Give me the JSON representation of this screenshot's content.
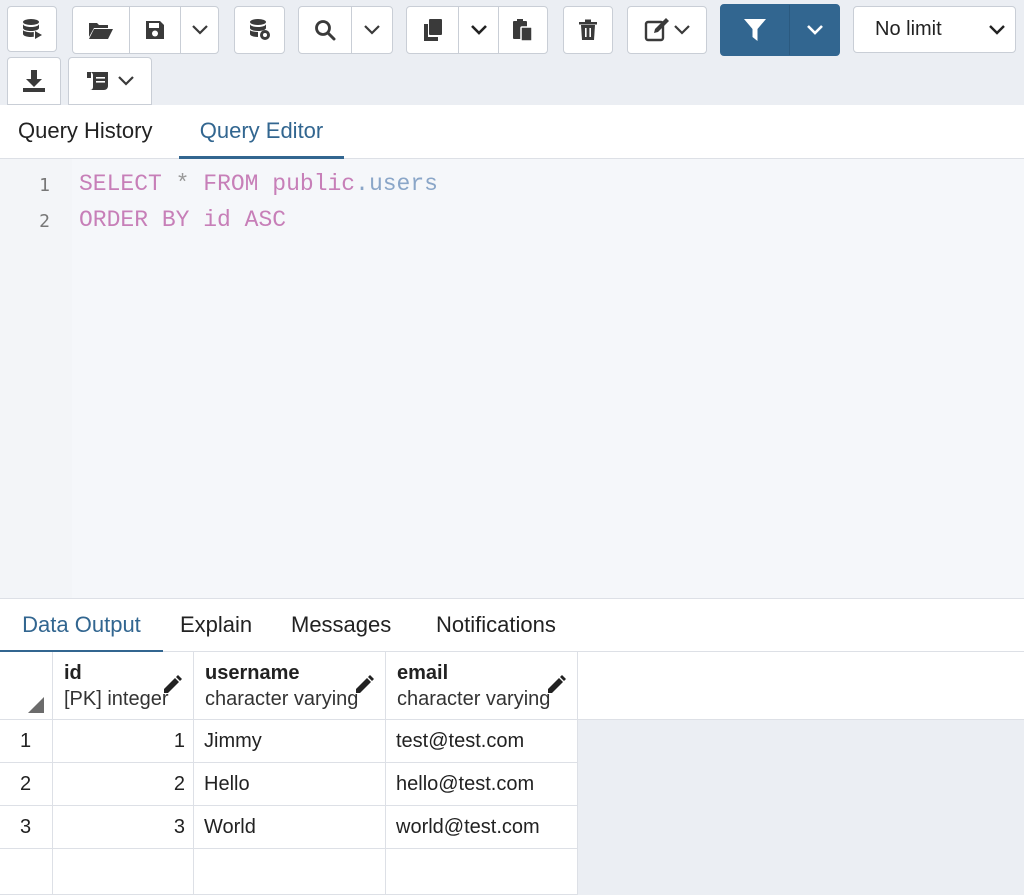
{
  "toolbar": {
    "limit_select": {
      "value": "No limit",
      "options": [
        "No limit"
      ]
    }
  },
  "tabs_top": [
    {
      "label": "Query History",
      "active": false
    },
    {
      "label": "Query Editor",
      "active": true
    }
  ],
  "editor": {
    "lines": [
      {
        "number": "1"
      },
      {
        "number": "2"
      }
    ],
    "line1": {
      "kw1": "SELECT",
      "op": "*",
      "kw2": "FROM",
      "schema": "public",
      "dot": ".",
      "table": "users"
    },
    "line2": {
      "kw1": "ORDER BY",
      "col": "id",
      "kw2": "ASC"
    }
  },
  "tabs_bottom": [
    {
      "label": "Data Output",
      "active": true
    },
    {
      "label": "Explain",
      "active": false
    },
    {
      "label": "Messages",
      "active": false
    },
    {
      "label": "Notifications",
      "active": false
    }
  ],
  "grid": {
    "columns": [
      {
        "name": "id",
        "type": "[PK] integer"
      },
      {
        "name": "username",
        "type": "character varying"
      },
      {
        "name": "email",
        "type": "character varying"
      }
    ],
    "rows": [
      {
        "rownum": "1",
        "id": "1",
        "username": "Jimmy",
        "email": "test@test.com"
      },
      {
        "rownum": "2",
        "id": "2",
        "username": "Hello",
        "email": "hello@test.com"
      },
      {
        "rownum": "3",
        "id": "3",
        "username": "World",
        "email": "world@test.com"
      }
    ]
  },
  "colors": {
    "accent": "#326690",
    "keyword": "#c77fb8",
    "identifier": "#8aa6c8"
  },
  "icons": [
    "database-play-icon",
    "folder-open-icon",
    "save-icon",
    "chevron-down-icon",
    "database-cog-icon",
    "search-icon",
    "copy-icon",
    "paste-icon",
    "trash-icon",
    "edit-icon",
    "filter-icon",
    "download-icon",
    "scroll-macro-icon",
    "pencil-icon"
  ]
}
